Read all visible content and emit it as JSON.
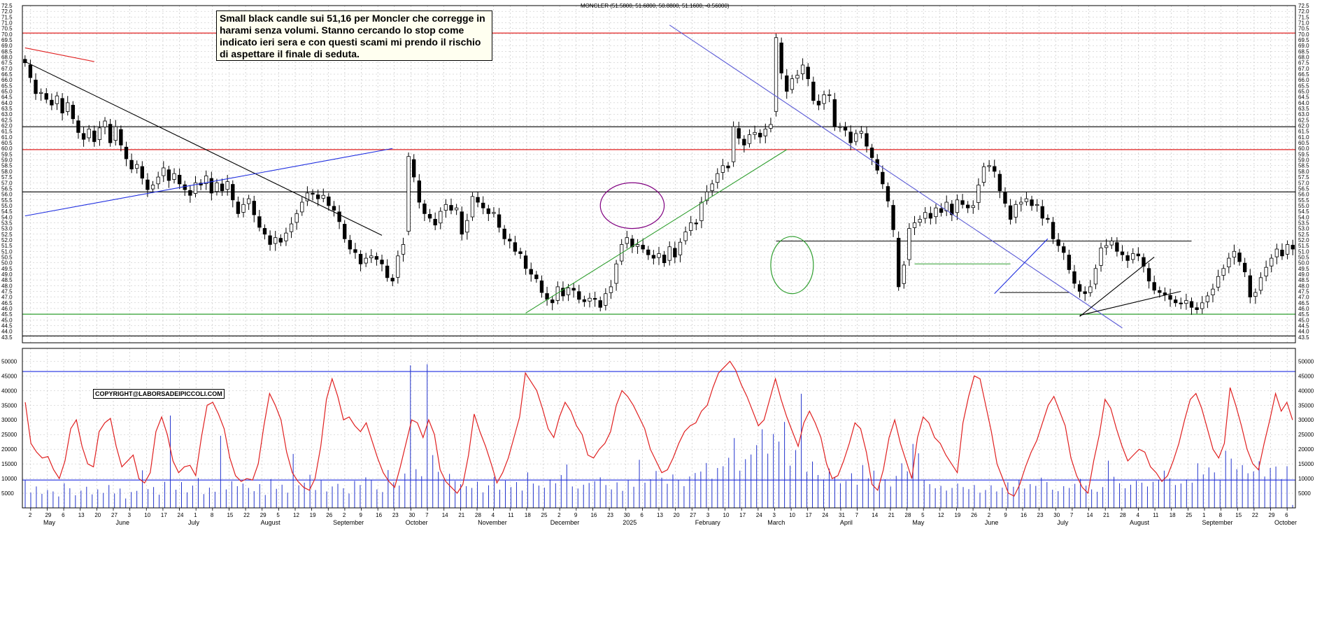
{
  "header": {
    "instrument_line": "MONCLER (51.5800, 51.6800, 50.8800, 51.1600, -0.56000)"
  },
  "annotation": {
    "text": "Small black candle sui 51,16 per Moncler che corregge in harami senza volumi. Stanno cercando lo stop come indicato ieri sera e con questi scami mi prendo il rischio di aspettare il finale di seduta."
  },
  "copyright": "COPYRIGHT@LABORSADEIPICCOLI.COM",
  "colors": {
    "candle": "#000000",
    "support": "#2e9e2e",
    "resistance": "#e02020",
    "level": "#000000",
    "trend_blue": "#1f2ee0",
    "trend_violet": "#5b5bd6",
    "volume_bar": "#2233cc",
    "volume_ma": "#e02020",
    "grid": "#bdbdbd",
    "ellipse_purple": "#800080",
    "ellipse_green": "#2e9e2e"
  },
  "chart_data": [
    {
      "type": "candlestick",
      "title": "MONCLER (51.5800, 51.6800, 50.8800, 51.1600, -0.56000)",
      "ylim": [
        43.0,
        72.5
      ],
      "y_ticks": [
        "72.5",
        "72.0",
        "71.5",
        "71.0",
        "70.5",
        "70.0",
        "69.5",
        "69.0",
        "68.5",
        "68.0",
        "67.5",
        "67.0",
        "66.5",
        "66.0",
        "65.5",
        "65.0",
        "64.5",
        "64.0",
        "63.5",
        "63.0",
        "62.5",
        "62.0",
        "61.5",
        "61.0",
        "60.5",
        "60.0",
        "59.5",
        "59.0",
        "58.5",
        "58.0",
        "57.5",
        "57.0",
        "56.5",
        "56.0",
        "55.5",
        "55.0",
        "54.5",
        "54.0",
        "53.5",
        "53.0",
        "52.5",
        "52.0",
        "51.5",
        "51.0",
        "50.5",
        "50.0",
        "49.5",
        "49.0",
        "48.5",
        "48.0",
        "47.5",
        "47.0",
        "46.5",
        "46.0",
        "45.5",
        "45.0",
        "44.5",
        "44.0",
        "43.5"
      ],
      "horizontal_levels": [
        {
          "value": 70.1,
          "color": "resistance"
        },
        {
          "value": 61.9,
          "color": "level"
        },
        {
          "value": 59.9,
          "color": "resistance"
        },
        {
          "value": 56.2,
          "color": "level"
        },
        {
          "value": 45.5,
          "color": "support"
        },
        {
          "value": 43.6,
          "color": "level"
        }
      ],
      "close_series": [
        67.5,
        66.2,
        64.8,
        64.9,
        64.3,
        63.8,
        64.6,
        63.1,
        64.0,
        62.6,
        61.4,
        60.8,
        61.7,
        60.6,
        61.8,
        62.4,
        60.5,
        61.9,
        60.3,
        59.1,
        58.2,
        58.6,
        57.4,
        56.4,
        56.8,
        57.5,
        58.3,
        57.2,
        57.8,
        56.9,
        56.4,
        55.9,
        57.0,
        56.8,
        57.6,
        56.1,
        57.0,
        56.3,
        57.1,
        55.5,
        54.3,
        55.1,
        55.6,
        54.2,
        53.1,
        52.5,
        51.6,
        52.2,
        51.8,
        52.6,
        53.4,
        54.3,
        55.3,
        56.1,
        56.0,
        55.6,
        55.9,
        55.0,
        54.6,
        53.6,
        52.1,
        51.2,
        50.9,
        49.9,
        50.4,
        50.6,
        50.3,
        49.9,
        48.7,
        48.4,
        50.6,
        51.6,
        59.3,
        57.5,
        55.3,
        54.3,
        53.9,
        53.3,
        54.5,
        55.1,
        54.6,
        54.8,
        52.5,
        53.7,
        55.8,
        55.3,
        54.8,
        54.3,
        54.4,
        53.1,
        52.1,
        51.9,
        51.0,
        50.8,
        49.5,
        49.0,
        48.6,
        47.4,
        46.8,
        46.5,
        47.9,
        47.1,
        47.8,
        47.6,
        46.8,
        46.6,
        46.9,
        46.8,
        46.1,
        47.3,
        47.9,
        49.9,
        51.6,
        52.2,
        51.4,
        51.6,
        51.2,
        50.7,
        50.4,
        50.8,
        50.0,
        51.4,
        50.5,
        51.8,
        52.7,
        53.5,
        53.4,
        55.3,
        56.2,
        56.9,
        57.8,
        58.5,
        58.3,
        61.9,
        60.9,
        60.3,
        61.2,
        61.4,
        61.0,
        61.7,
        62.1,
        69.7,
        66.6,
        65.0,
        66.1,
        66.4,
        67.3,
        66.1,
        64.2,
        63.8,
        64.7,
        64.7,
        61.9,
        61.9,
        61.6,
        60.5,
        61.3,
        61.5,
        60.2,
        59.2,
        58.1,
        56.9,
        55.4,
        52.9,
        47.9,
        49.8,
        53.0,
        53.5,
        53.8,
        54.4,
        53.9,
        54.8,
        54.4,
        55.3,
        54.2,
        55.5,
        55.1,
        54.8,
        55.0,
        56.8,
        58.4,
        58.5,
        58.0,
        56.3,
        55.2,
        53.8,
        55.1,
        55.3,
        55.6,
        55.0,
        55.1,
        53.9,
        53.8,
        52.1,
        51.5,
        50.9,
        49.4,
        48.2,
        47.5,
        47.3,
        47.9,
        49.5,
        51.3,
        51.5,
        51.9,
        51.0,
        50.7,
        50.2,
        50.8,
        50.6,
        49.7,
        48.4,
        47.6,
        47.4,
        47.2,
        46.8,
        46.5,
        46.4,
        46.7,
        46.1,
        45.9,
        46.5,
        47.1,
        47.7,
        48.8,
        49.5,
        50.4,
        51.0,
        50.1,
        49.2,
        47.0,
        47.4,
        48.7,
        49.6,
        50.4,
        51.2,
        50.6,
        51.6,
        51.2
      ],
      "trendlines": [
        {
          "from": [
            0,
            67.6
          ],
          "to": [
            67,
            52.4
          ],
          "color": "level"
        },
        {
          "from": [
            0,
            54.1
          ],
          "to": [
            69,
            60.0
          ],
          "color": "trend_blue"
        },
        {
          "from": [
            0,
            68.8
          ],
          "to": [
            13,
            67.6
          ],
          "color": "resistance"
        },
        {
          "from": [
            94,
            45.6
          ],
          "to": [
            143,
            59.9
          ],
          "color": "support"
        },
        {
          "from": [
            121,
            70.8
          ],
          "to": [
            206,
            44.3
          ],
          "color": "trend_violet"
        },
        {
          "from": [
            198,
            45.4
          ],
          "to": [
            217,
            47.5
          ],
          "color": "level"
        },
        {
          "from": [
            198,
            45.3
          ],
          "to": [
            212,
            50.5
          ],
          "color": "level"
        },
        {
          "from": [
            182,
            47.3
          ],
          "to": [
            192,
            52.1
          ],
          "color": "trend_blue"
        }
      ],
      "segments": [
        {
          "from": [
            141,
            51.9
          ],
          "to": [
            219,
            51.9
          ],
          "color": "level"
        },
        {
          "from": [
            167,
            49.9
          ],
          "to": [
            185,
            49.9
          ],
          "color": "support"
        },
        {
          "from": [
            183,
            47.4
          ],
          "to": [
            196,
            47.4
          ],
          "color": "level"
        }
      ],
      "ellipses": [
        {
          "center": [
            114,
            55.0
          ],
          "rx_bars": 6,
          "ry_price": 2.0,
          "color": "ellipse_purple"
        },
        {
          "center": [
            144,
            49.8
          ],
          "rx_bars": 4,
          "ry_price": 2.5,
          "color": "ellipse_green"
        }
      ]
    },
    {
      "type": "bar",
      "name_hidden": true,
      "ylim": [
        0,
        52000
      ],
      "y_ticks": [
        "50000",
        "45000",
        "40000",
        "35000",
        "30000",
        "25000",
        "20000",
        "15000",
        "10000",
        "5000"
      ],
      "horizontal_levels": [
        {
          "value": 46500,
          "color": "trend_blue"
        },
        {
          "value": 9500,
          "color": "trend_blue"
        }
      ],
      "volume_ma": [
        36000,
        22000,
        19000,
        17000,
        17500,
        13000,
        10000,
        16000,
        27000,
        30000,
        21000,
        15000,
        14000,
        26000,
        29000,
        30500,
        21000,
        14000,
        16000,
        18000,
        10000,
        8500,
        12000,
        26000,
        31000,
        25000,
        16000,
        12000,
        14000,
        14500,
        11000,
        24000,
        35000,
        36000,
        32000,
        27000,
        17000,
        11000,
        9000,
        10000,
        9500,
        15000,
        28000,
        39000,
        35000,
        30000,
        19000,
        12000,
        9000,
        7000,
        6000,
        10000,
        21000,
        37000,
        44000,
        38000,
        30000,
        31000,
        28000,
        26000,
        29000,
        23000,
        17000,
        12000,
        9000,
        7000,
        14000,
        22000,
        30000,
        29000,
        24000,
        30000,
        25000,
        13000,
        9000,
        7000,
        5000,
        8000,
        18000,
        32000,
        26000,
        21000,
        15000,
        8500,
        12000,
        17000,
        24000,
        31000,
        46000,
        43000,
        40000,
        34000,
        27000,
        24000,
        31000,
        36000,
        33000,
        28000,
        25000,
        18000,
        17000,
        20000,
        22000,
        26000,
        35000,
        40000,
        38000,
        35000,
        31000,
        27000,
        20000,
        16000,
        12000,
        13000,
        17000,
        22000,
        26000,
        28000,
        29000,
        33000,
        35000,
        41000,
        46000,
        48000,
        50000,
        47000,
        42000,
        38000,
        33000,
        28000,
        30000,
        37000,
        44000,
        37000,
        31000,
        26000,
        21000,
        29000,
        33000,
        29000,
        24000,
        15000,
        10000,
        11000,
        16000,
        22000,
        29000,
        27000,
        19000,
        8000,
        6000,
        13000,
        24000,
        30000,
        22000,
        16000,
        10000,
        24000,
        31000,
        29000,
        24000,
        22000,
        18000,
        15000,
        12000,
        29000,
        38000,
        45000,
        44000,
        35000,
        26000,
        15000,
        10000,
        5000,
        4000,
        8000,
        14000,
        19000,
        23000,
        29000,
        35000,
        38000,
        33000,
        28000,
        17000,
        11000,
        7000,
        5000,
        16000,
        25000,
        37000,
        34000,
        27000,
        21000,
        16000,
        18000,
        20000,
        19000,
        14000,
        12000,
        9000,
        11000,
        16000,
        22000,
        30000,
        37000,
        39000,
        34000,
        27000,
        20000,
        17000,
        22000,
        41000,
        35000,
        28000,
        20000,
        15000,
        13000,
        22000,
        30000,
        39000,
        33000,
        36000,
        30000
      ],
      "volume_bars": [
        9500,
        5200,
        7300,
        4800,
        6100,
        5600,
        3900,
        8400,
        6700,
        4300,
        5900,
        7200,
        4600,
        6300,
        5100,
        7800,
        4900,
        6600,
        3200,
        5400,
        5800,
        12800,
        6400,
        7100,
        4500,
        8900,
        31500,
        6200,
        8800,
        5300,
        7600,
        10200,
        4700,
        6900,
        5500,
        24600,
        6300,
        9100,
        7400,
        8300,
        6800,
        5700,
        8100,
        4400,
        9800,
        6500,
        7900,
        5200,
        18400,
        7700,
        8600,
        11300,
        6100,
        9400,
        5600,
        7300,
        8200,
        6700,
        4900,
        9200,
        7800,
        10400,
        9600,
        6300,
        5400,
        12900,
        8700,
        7600,
        11700,
        48600,
        13200,
        10800,
        49000,
        18000,
        12300,
        9700,
        11600,
        9200,
        8100,
        7400,
        6800,
        8900,
        5300,
        7700,
        10600,
        6200,
        9300,
        7100,
        8800,
        5900,
        12100,
        8300,
        7600,
        6900,
        9700,
        8400,
        11200,
        14800,
        7300,
        6600,
        7900,
        8500,
        9100,
        10400,
        7800,
        6300,
        8700,
        5800,
        9400,
        7200,
        16400,
        8600,
        9800,
        12600,
        10300,
        8200,
        11400,
        9600,
        7400,
        10700,
        11900,
        12400,
        15300,
        9900,
        13600,
        14200,
        17100,
        23800,
        12700,
        16600,
        18200,
        21400,
        26800,
        18500,
        25200,
        22600,
        29300,
        14400,
        19700,
        38900,
        12300,
        15800,
        11200,
        9700,
        13400,
        10600,
        8400,
        9200,
        11800,
        7900,
        14600,
        10100,
        12700,
        8600,
        9800,
        7300,
        10900,
        15200,
        12400,
        21800,
        18600,
        9400,
        8100,
        6700,
        7500,
        5900,
        6800,
        8300,
        7100,
        6400,
        7800,
        5200,
        6100,
        7700,
        5600,
        6900,
        8700,
        7200,
        9600,
        6600,
        8100,
        7500,
        10300,
        8800,
        6200,
        5700,
        7400,
        6800,
        8200,
        9900,
        7600,
        6300,
        5500,
        7100,
        16100,
        10600,
        8400,
        6700,
        7900,
        9200,
        8600,
        7300,
        8900,
        9500,
        12700,
        10100,
        7800,
        8300,
        9700,
        8600,
        15200,
        11400,
        13800,
        12100,
        9600,
        19500,
        16800,
        13200,
        14600,
        11800,
        12400,
        15900,
        10700,
        13600,
        14100,
        9800,
        14200,
        1000
      ]
    }
  ],
  "x_axis": {
    "day_ticks": [
      "2",
      "29",
      "6",
      "13",
      "20",
      "27",
      "3",
      "10",
      "17",
      "24",
      "1",
      "8",
      "15",
      "22",
      "29",
      "5",
      "12",
      "19",
      "26",
      "2",
      "9",
      "16",
      "23",
      "30",
      "7",
      "14",
      "21",
      "28",
      "4",
      "11",
      "18",
      "25",
      "2",
      "9",
      "16",
      "23",
      "30",
      "6",
      "13",
      "20",
      "27",
      "3",
      "10",
      "17",
      "24",
      "3",
      "10",
      "17",
      "24",
      "31",
      "7",
      "14",
      "21",
      "28",
      "5",
      "12",
      "19",
      "26",
      "2",
      "9",
      "16",
      "23",
      "30",
      "7",
      "14",
      "21",
      "28",
      "4",
      "11",
      "18",
      "25",
      "1",
      "8",
      "15",
      "22",
      "29",
      "6"
    ],
    "months": [
      "May",
      "June",
      "July",
      "August",
      "September",
      "October",
      "November",
      "December",
      "2025",
      "February",
      "March",
      "April",
      "May",
      "June",
      "July",
      "August",
      "September",
      "October"
    ]
  }
}
